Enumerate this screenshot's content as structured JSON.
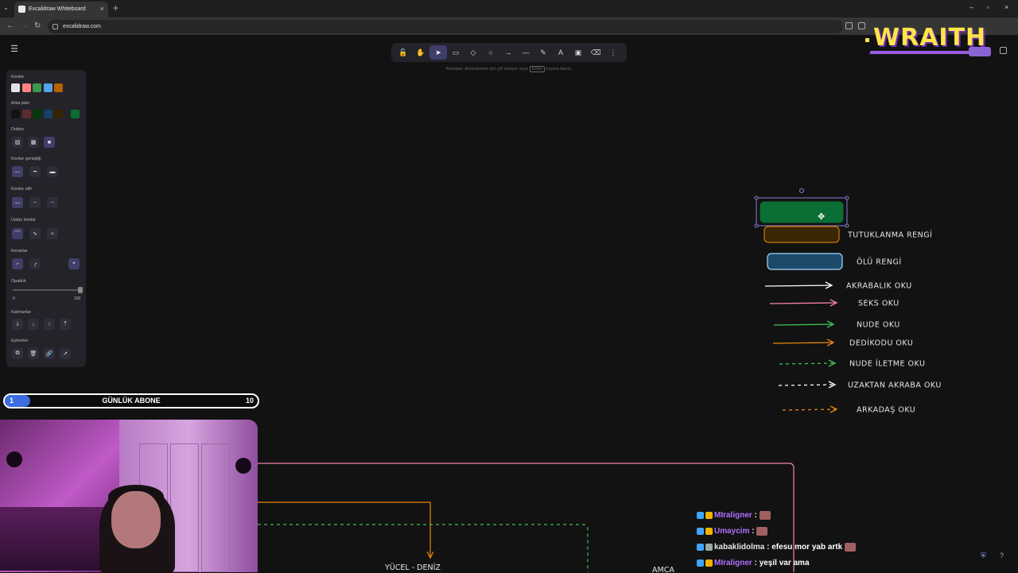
{
  "browser": {
    "tab_title": "Excalidraw Whiteboard",
    "tab_close": "×",
    "new_tab": "+",
    "url": "excalidraw.com",
    "window_controls": [
      "–",
      "▫",
      "×"
    ]
  },
  "toolbar": {
    "tools": [
      {
        "name": "lock",
        "glyph": "🔓"
      },
      {
        "name": "hand",
        "glyph": "✋"
      },
      {
        "name": "selection",
        "glyph": "➤",
        "active": true
      },
      {
        "name": "rectangle",
        "glyph": "▭"
      },
      {
        "name": "diamond",
        "glyph": "◇"
      },
      {
        "name": "ellipse",
        "glyph": "○"
      },
      {
        "name": "arrow",
        "glyph": "→"
      },
      {
        "name": "line",
        "glyph": "—"
      },
      {
        "name": "draw",
        "glyph": "✎"
      },
      {
        "name": "text",
        "glyph": "A"
      },
      {
        "name": "image",
        "glyph": "▣"
      },
      {
        "name": "eraser",
        "glyph": "⌫"
      },
      {
        "name": "more",
        "glyph": "⋮"
      }
    ],
    "hint_before": "Noktaları düzenlemek için çift tıklayın veya",
    "hint_key": "Enter",
    "hint_after": "tuşuna basın."
  },
  "panel": {
    "stroke_label": "Kontur",
    "background_label": "Arka plan",
    "fill_label": "Doldur",
    "stroke_width_label": "Kontur genişliği",
    "stroke_style_label": "Kontur stili",
    "sloppiness_label": "Üstün körlük",
    "edges_label": "Kenarlar",
    "opacity_label": "Opaklık",
    "opacity_min": "0",
    "opacity_max": "100",
    "layers_label": "Katmanlar",
    "actions_label": "Eylemler",
    "stroke_colors": [
      "#e3e3e3",
      "#ff8383",
      "#3a994c",
      "#56a2e8",
      "#b76100"
    ],
    "background_colors": [
      "#121212",
      "#5b2c2c",
      "#043b0c",
      "#154163",
      "#362500",
      "#0a6e35"
    ]
  },
  "subscriber_goal": {
    "current": "1",
    "title": "GÜNLÜK ABONE",
    "goal": "10",
    "progress": 0.1
  },
  "logo": {
    "text": "WRAITH"
  },
  "legend": [
    {
      "label": "TUTUKLANMA RENGİ",
      "kind": "box",
      "color": "#c77c00",
      "fill": "#3a2600"
    },
    {
      "label": "ÖLÜ RENGİ",
      "kind": "box",
      "color": "#a5d8ff",
      "fill": "#1b4a6b"
    },
    {
      "label": "AKRABALIK OKU",
      "kind": "arrow",
      "color": "#ffffff",
      "dashed": false
    },
    {
      "label": "SEKS OKU",
      "kind": "arrow",
      "color": "#f783ac",
      "dashed": false
    },
    {
      "label": "NUDE OKU",
      "kind": "arrow",
      "color": "#40c057",
      "dashed": false
    },
    {
      "label": "DEDİKODU OKU",
      "kind": "arrow",
      "color": "#e8870f",
      "dashed": false
    },
    {
      "label": "NUDE İLETME OKU",
      "kind": "arrow",
      "color": "#40c057",
      "dashed": true
    },
    {
      "label": "UZAKTAN AKRABA OKU",
      "kind": "arrow",
      "color": "#ffffff",
      "dashed": true
    },
    {
      "label": "ARKADAŞ OKU",
      "kind": "arrow",
      "color": "#e8870f",
      "dashed": true
    }
  ],
  "selected_box_color": "#0a6e35",
  "diagram_labels": {
    "left_label": "YÜCEL - DENİZ",
    "amca": "AMCA"
  },
  "chat": [
    {
      "user": "MIraligner",
      "message": "",
      "color": "#b070ff",
      "emote": true
    },
    {
      "user": "Umaycim",
      "message": "",
      "color": "#b070ff",
      "emote": true
    },
    {
      "user": "kabaklidolma",
      "message": "efesu mor yab artk",
      "color": "#e6e6e6",
      "emote": true
    },
    {
      "user": "MIraligner",
      "message": "yeşil var ama",
      "color": "#b070ff",
      "emote": false
    }
  ]
}
